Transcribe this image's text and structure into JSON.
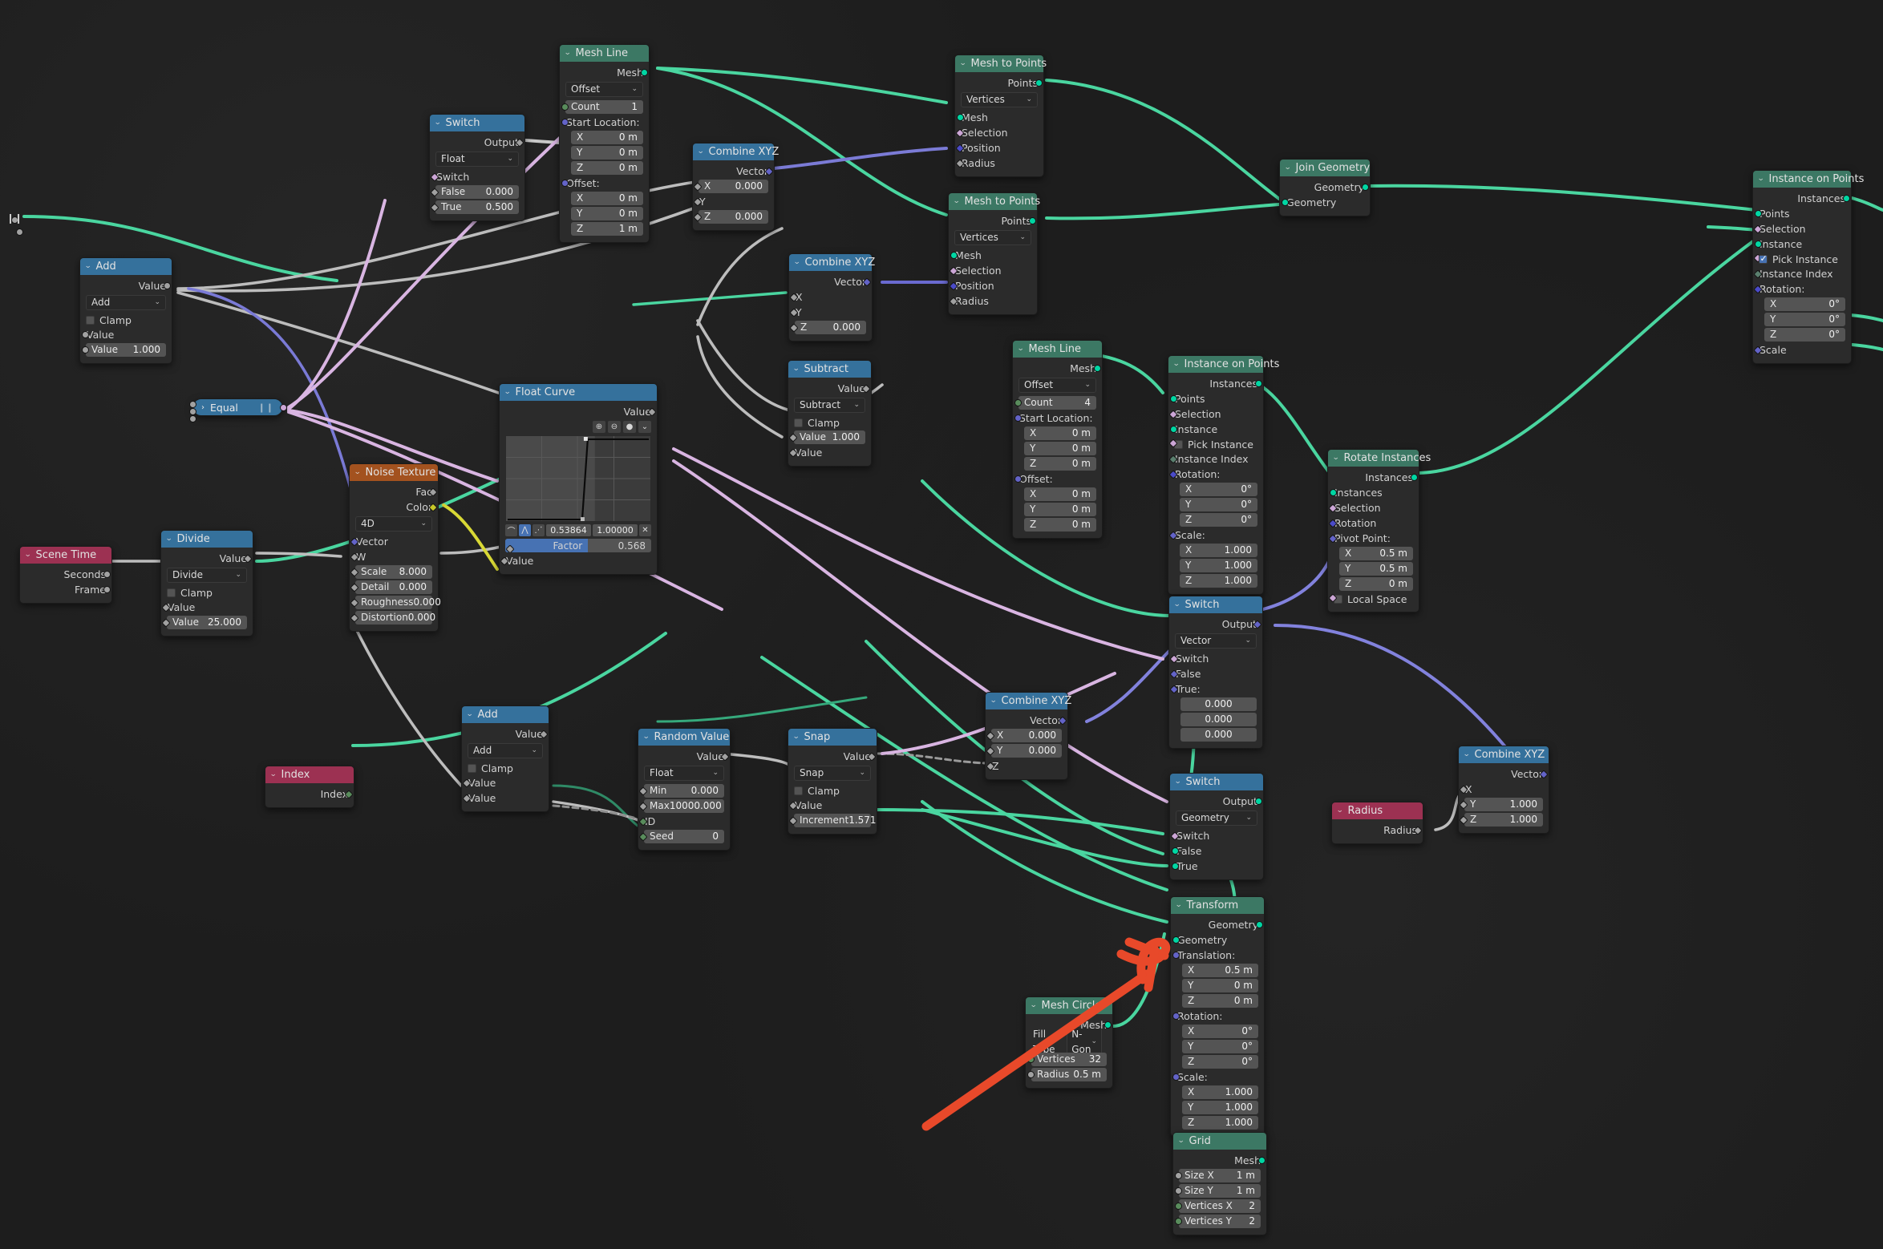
{
  "app": {
    "editor": "Blender Geometry Node Editor",
    "background": "#1d1d1d"
  },
  "colors": {
    "header_geometry": "#3c7864",
    "header_converter": "#35719c",
    "header_input": "#9c3152",
    "header_texture": "#a3521f",
    "annotation": "#e8492a"
  },
  "labels": {
    "caret": "⌄",
    "dropdown_caret": "⌄",
    "grip": "❙❙"
  },
  "nodes": {
    "switch_float": {
      "title": "Switch",
      "outputs": [
        "Output"
      ],
      "dropdown": "Float",
      "inputs": [
        "Switch"
      ],
      "fields": [
        {
          "label": "False",
          "value": "0.000"
        },
        {
          "label": "True",
          "value": "0.500"
        }
      ]
    },
    "mesh_line_top": {
      "title": "Mesh Line",
      "outputs": [
        "Mesh"
      ],
      "dropdown": "Offset",
      "count": {
        "label": "Count",
        "value": "1"
      },
      "start_location_label": "Start Location:",
      "start_location": [
        {
          "label": "X",
          "value": "0 m"
        },
        {
          "label": "Y",
          "value": "0 m"
        },
        {
          "label": "Z",
          "value": "0 m"
        }
      ],
      "offset_label": "Offset:",
      "offset": [
        {
          "label": "X",
          "value": "0 m"
        },
        {
          "label": "Y",
          "value": "0 m"
        },
        {
          "label": "Z",
          "value": "1 m"
        }
      ]
    },
    "combine_xyz_top": {
      "title": "Combine XYZ",
      "outputs": [
        "Vector"
      ],
      "fields": [
        {
          "label": "X",
          "value": "0.000",
          "field": true
        },
        {
          "label": "Y",
          "value": "",
          "field": false
        },
        {
          "label": "Z",
          "value": "0.000",
          "field": true
        }
      ]
    },
    "mesh_to_points_1": {
      "title": "Mesh to Points",
      "outputs": [
        "Points"
      ],
      "dropdown": "Vertices",
      "inputs": [
        "Mesh",
        "Selection",
        "Position",
        "Radius"
      ]
    },
    "mesh_to_points_2": {
      "title": "Mesh to Points",
      "outputs": [
        "Points"
      ],
      "dropdown": "Vertices",
      "inputs": [
        "Mesh",
        "Selection",
        "Position",
        "Radius"
      ]
    },
    "join_geometry": {
      "title": "Join Geometry",
      "outputs": [
        "Geometry"
      ],
      "inputs": [
        "Geometry"
      ]
    },
    "instance_on_points_right": {
      "title": "Instance on Points",
      "outputs": [
        "Instances"
      ],
      "inputs": [
        "Points",
        "Selection",
        "Instance"
      ],
      "pick_instance": {
        "label": "Pick Instance",
        "checked": true
      },
      "instance_index": "Instance Index",
      "rotation_label": "Rotation:",
      "rotation": [
        {
          "label": "X",
          "value": "0°"
        },
        {
          "label": "Y",
          "value": "0°"
        },
        {
          "label": "Z",
          "value": "0°"
        }
      ],
      "scale_label": "Scale"
    },
    "add_left": {
      "title": "Add",
      "outputs": [
        "Value"
      ],
      "dropdown": "Add",
      "clamp": {
        "label": "Clamp",
        "checked": false
      },
      "inputs": [
        "Value"
      ],
      "fields": [
        {
          "label": "Value",
          "value": "1.000"
        }
      ]
    },
    "combine_xyz_mid": {
      "title": "Combine XYZ",
      "outputs": [
        "Vector"
      ],
      "fields": [
        {
          "label": "X",
          "value": "",
          "field": false
        },
        {
          "label": "Y",
          "value": "",
          "field": false
        },
        {
          "label": "Z",
          "value": "0.000",
          "field": true
        }
      ]
    },
    "subtract": {
      "title": "Subtract",
      "outputs": [
        "Value"
      ],
      "dropdown": "Subtract",
      "clamp": {
        "label": "Clamp",
        "checked": false
      },
      "fields": [
        {
          "label": "Value",
          "value": "1.000"
        }
      ],
      "inputs": [
        "Value"
      ]
    },
    "equal": {
      "title": "Equal",
      "collapsed": true
    },
    "float_curve": {
      "title": "Float Curve",
      "outputs": [
        "Value"
      ],
      "tools": [
        "⊕",
        "⊖",
        "●",
        "⌄"
      ],
      "handle_icons": [
        "⌒",
        "⋀",
        "⋰"
      ],
      "coord_x": "0.53864",
      "coord_y": "1.00000",
      "delete_icon": "✕",
      "factor": {
        "label": "Factor",
        "value": "0.568",
        "fill_pct": 56.8
      },
      "inputs": [
        "Value"
      ]
    },
    "noise_texture": {
      "title": "Noise Texture",
      "outputs": [
        "Fac",
        "Color"
      ],
      "dropdown": "4D",
      "inputs": [
        "Vector",
        "W"
      ],
      "fields": [
        {
          "label": "Scale",
          "value": "8.000"
        },
        {
          "label": "Detail",
          "value": "0.000"
        },
        {
          "label": "Roughness",
          "value": "0.000"
        },
        {
          "label": "Distortion",
          "value": "0.000"
        }
      ]
    },
    "scene_time": {
      "title": "Scene Time",
      "outputs": [
        "Seconds",
        "Frame"
      ]
    },
    "divide": {
      "title": "Divide",
      "outputs": [
        "Value"
      ],
      "dropdown": "Divide",
      "clamp": {
        "label": "Clamp",
        "checked": false
      },
      "inputs": [
        "Value"
      ],
      "fields": [
        {
          "label": "Value",
          "value": "25.000"
        }
      ]
    },
    "mesh_line_mid": {
      "title": "Mesh Line",
      "outputs": [
        "Mesh"
      ],
      "dropdown": "Offset",
      "count": {
        "label": "Count",
        "value": "4"
      },
      "start_location_label": "Start Location:",
      "start_location": [
        {
          "label": "X",
          "value": "0 m"
        },
        {
          "label": "Y",
          "value": "0 m"
        },
        {
          "label": "Z",
          "value": "0 m"
        }
      ],
      "offset_label": "Offset:",
      "offset": [
        {
          "label": "X",
          "value": "0 m"
        },
        {
          "label": "Y",
          "value": "0 m"
        },
        {
          "label": "Z",
          "value": "0 m"
        }
      ]
    },
    "instance_on_points_mid": {
      "title": "Instance on Points",
      "outputs": [
        "Instances"
      ],
      "inputs": [
        "Points",
        "Selection",
        "Instance"
      ],
      "pick_instance": {
        "label": "Pick Instance",
        "checked": false
      },
      "instance_index": "Instance Index",
      "rotation_label": "Rotation:",
      "rotation": [
        {
          "label": "X",
          "value": "0°"
        },
        {
          "label": "Y",
          "value": "0°"
        },
        {
          "label": "Z",
          "value": "0°"
        }
      ],
      "scale_label": "Scale:",
      "scale": [
        {
          "label": "X",
          "value": "1.000"
        },
        {
          "label": "Y",
          "value": "1.000"
        },
        {
          "label": "Z",
          "value": "1.000"
        }
      ]
    },
    "rotate_instances": {
      "title": "Rotate Instances",
      "outputs": [
        "Instances"
      ],
      "inputs": [
        "Instances",
        "Selection",
        "Rotation"
      ],
      "pivot_label": "Pivot Point:",
      "pivot": [
        {
          "label": "X",
          "value": "0.5 m"
        },
        {
          "label": "Y",
          "value": "0.5 m"
        },
        {
          "label": "Z",
          "value": "0 m"
        }
      ],
      "local_space": {
        "label": "Local Space",
        "checked": false
      }
    },
    "switch_vector": {
      "title": "Switch",
      "outputs": [
        "Output"
      ],
      "dropdown": "Vector",
      "inputs": [
        "Switch",
        "False"
      ],
      "true_label": "True:",
      "true_values": [
        "0.000",
        "0.000",
        "0.000"
      ]
    },
    "switch_geometry": {
      "title": "Switch",
      "outputs": [
        "Output"
      ],
      "dropdown": "Geometry",
      "inputs": [
        "Switch",
        "False",
        "True"
      ]
    },
    "combine_xyz_low": {
      "title": "Combine XYZ",
      "outputs": [
        "Vector"
      ],
      "fields": [
        {
          "label": "X",
          "value": "0.000",
          "field": true
        },
        {
          "label": "Y",
          "value": "0.000",
          "field": true
        },
        {
          "label": "Z",
          "value": "",
          "field": false
        }
      ]
    },
    "combine_xyz_right": {
      "title": "Combine XYZ",
      "outputs": [
        "Vector"
      ],
      "fields": [
        {
          "label": "X",
          "value": "",
          "field": false
        },
        {
          "label": "Y",
          "value": "1.000",
          "field": true
        },
        {
          "label": "Z",
          "value": "1.000",
          "field": true
        }
      ]
    },
    "radius": {
      "title": "Radius",
      "outputs": [
        "Radius"
      ]
    },
    "index": {
      "title": "Index",
      "outputs": [
        "Index"
      ]
    },
    "add_bottom": {
      "title": "Add",
      "outputs": [
        "Value"
      ],
      "dropdown": "Add",
      "clamp": {
        "label": "Clamp",
        "checked": false
      },
      "inputs": [
        "Value",
        "Value"
      ]
    },
    "random_value": {
      "title": "Random Value",
      "outputs": [
        "Value"
      ],
      "dropdown": "Float",
      "fields": [
        {
          "label": "Min",
          "value": "0.000"
        },
        {
          "label": "Max",
          "value": "10000.000"
        }
      ],
      "inputs": [
        "ID"
      ],
      "seed": {
        "label": "Seed",
        "value": "0"
      }
    },
    "snap": {
      "title": "Snap",
      "outputs": [
        "Value"
      ],
      "dropdown": "Snap",
      "clamp": {
        "label": "Clamp",
        "checked": false
      },
      "inputs": [
        "Value"
      ],
      "fields": [
        {
          "label": "Increment",
          "value": "1.571"
        }
      ]
    },
    "transform": {
      "title": "Transform",
      "outputs": [
        "Geometry"
      ],
      "inputs": [
        "Geometry"
      ],
      "translation_label": "Translation:",
      "translation": [
        {
          "label": "X",
          "value": "0.5 m"
        },
        {
          "label": "Y",
          "value": "0 m"
        },
        {
          "label": "Z",
          "value": "0 m"
        }
      ],
      "rotation_label": "Rotation:",
      "rotation": [
        {
          "label": "X",
          "value": "0°"
        },
        {
          "label": "Y",
          "value": "0°"
        },
        {
          "label": "Z",
          "value": "0°"
        }
      ],
      "scale_label": "Scale:",
      "scale": [
        {
          "label": "X",
          "value": "1.000"
        },
        {
          "label": "Y",
          "value": "1.000"
        },
        {
          "label": "Z",
          "value": "1.000"
        }
      ]
    },
    "mesh_circle": {
      "title": "Mesh Circle",
      "outputs": [
        "Mesh"
      ],
      "fill_type": {
        "label": "Fill Type",
        "value": "N-Gon"
      },
      "fields": [
        {
          "label": "Vertices",
          "value": "32"
        },
        {
          "label": "Radius",
          "value": "0.5 m"
        }
      ]
    },
    "grid": {
      "title": "Grid",
      "outputs": [
        "Mesh"
      ],
      "fields": [
        {
          "label": "Size X",
          "value": "1 m"
        },
        {
          "label": "Size Y",
          "value": "1 m"
        },
        {
          "label": "Vertices X",
          "value": "2"
        },
        {
          "label": "Vertices Y",
          "value": "2"
        }
      ]
    }
  }
}
